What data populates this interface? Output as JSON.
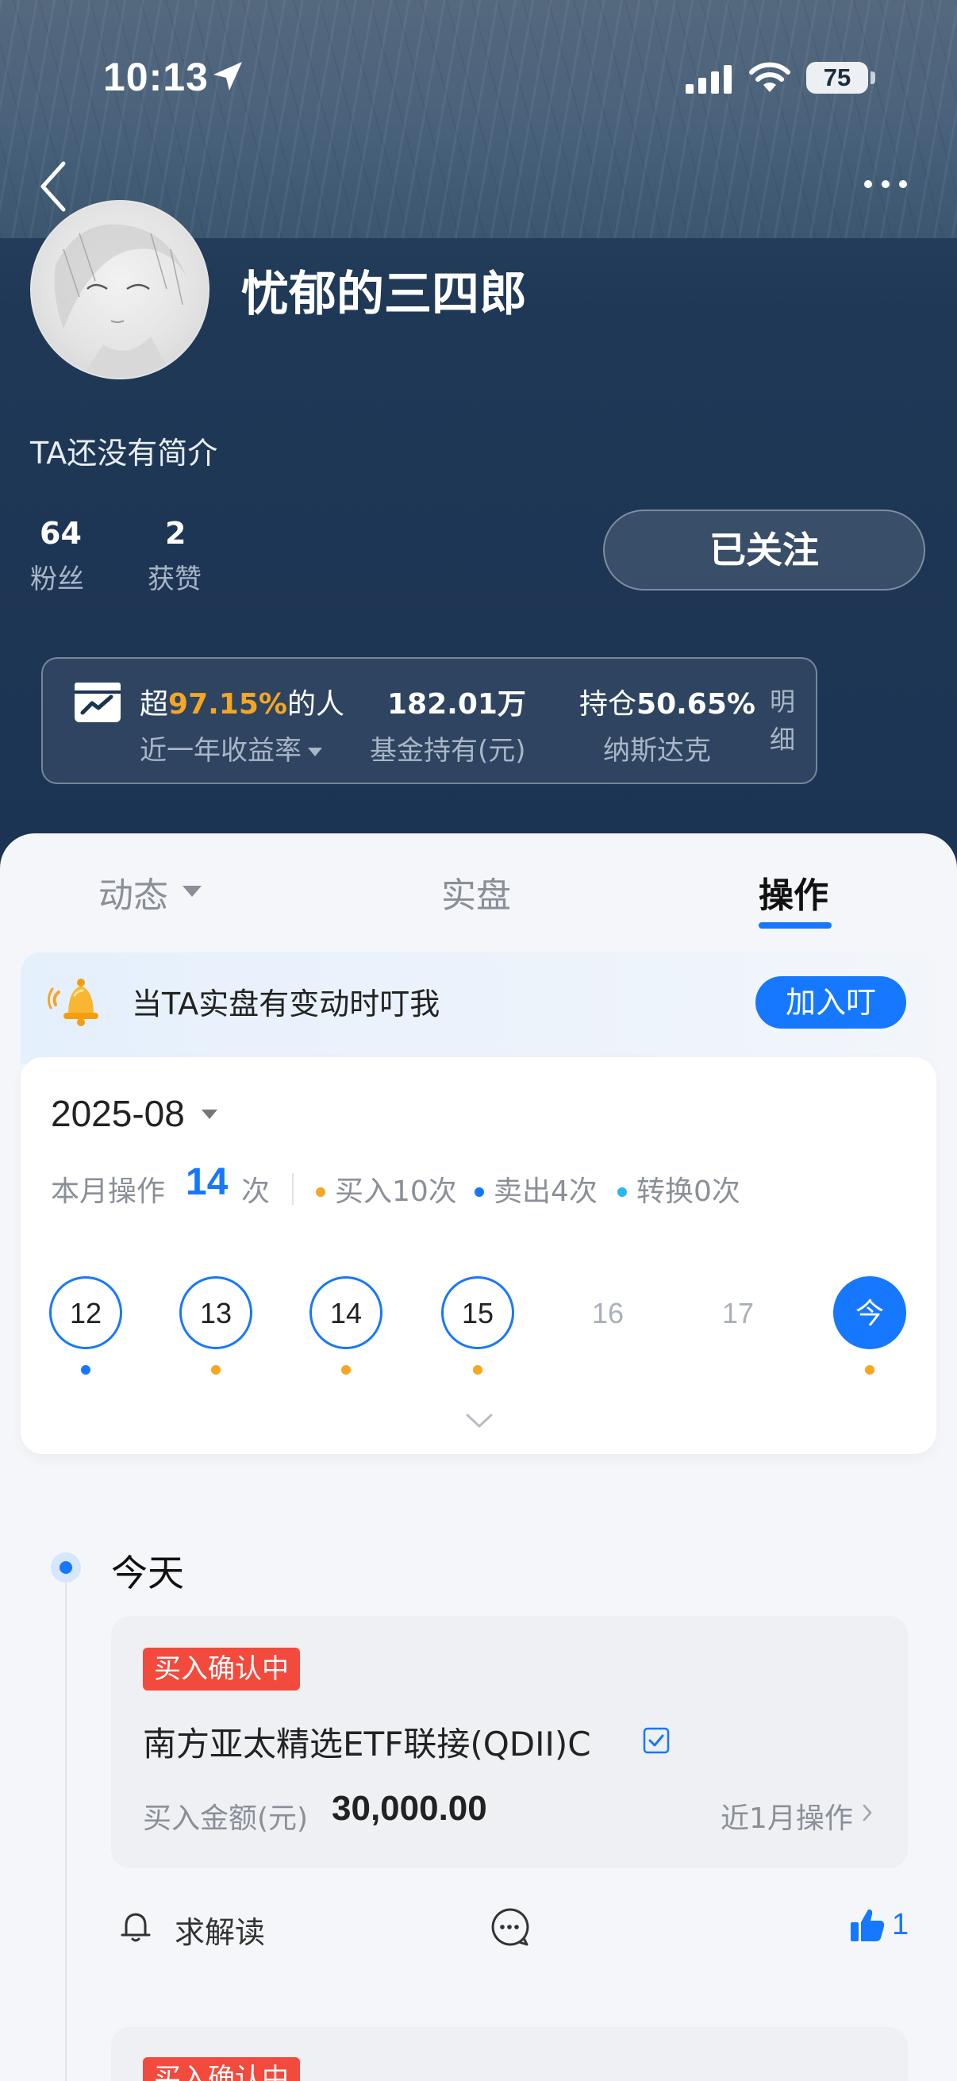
{
  "status_bar": {
    "time": "10:13",
    "battery": "75"
  },
  "profile": {
    "username": "忧郁的三四郎",
    "bio": "TA还没有简介",
    "fans_count": "64",
    "fans_label": "粉丝",
    "likes_count": "2",
    "likes_label": "获赞",
    "follow_button": "已关注"
  },
  "summary": {
    "beat_prefix": "超",
    "beat_pct": "97.15%",
    "beat_suffix": "的人",
    "beat_label": "近一年收益率",
    "holding_amount": "182.01万",
    "holding_label": "基金持有(元)",
    "position_prefix": "持仓",
    "position_pct": "50.65%",
    "position_label": "纳斯达克",
    "detail_label_1": "明",
    "detail_label_2": "细"
  },
  "tabs": [
    {
      "label": "动态"
    },
    {
      "label": "实盘"
    },
    {
      "label": "操作"
    }
  ],
  "notify": {
    "text": "当TA实盘有变动时叮我",
    "button": "加入叮"
  },
  "calendar": {
    "month": "2025-08",
    "month_ops_label": "本月操作",
    "month_ops_count": "14",
    "month_ops_unit": "次",
    "buy": "买入10次",
    "sell": "卖出4次",
    "convert": "转换0次",
    "days": [
      "12",
      "13",
      "14",
      "15",
      "16",
      "17",
      "今"
    ]
  },
  "timeline": {
    "label": "今天",
    "card": {
      "badge": "买入确认中",
      "fund": "南方亚太精选ETF联接(QDII)C",
      "amount_label": "买入金额(元)",
      "amount": "30,000.00",
      "recent": "近1月操作"
    },
    "ask_label": "求解读",
    "like_count": "1",
    "card2_badge": "买入确认中"
  },
  "colors": {
    "accent": "#1677ff",
    "buy_dot": "#f5a623",
    "sell_dot": "#1677ff",
    "convert_dot": "#29b6f6",
    "badge": "#f24a3d"
  }
}
